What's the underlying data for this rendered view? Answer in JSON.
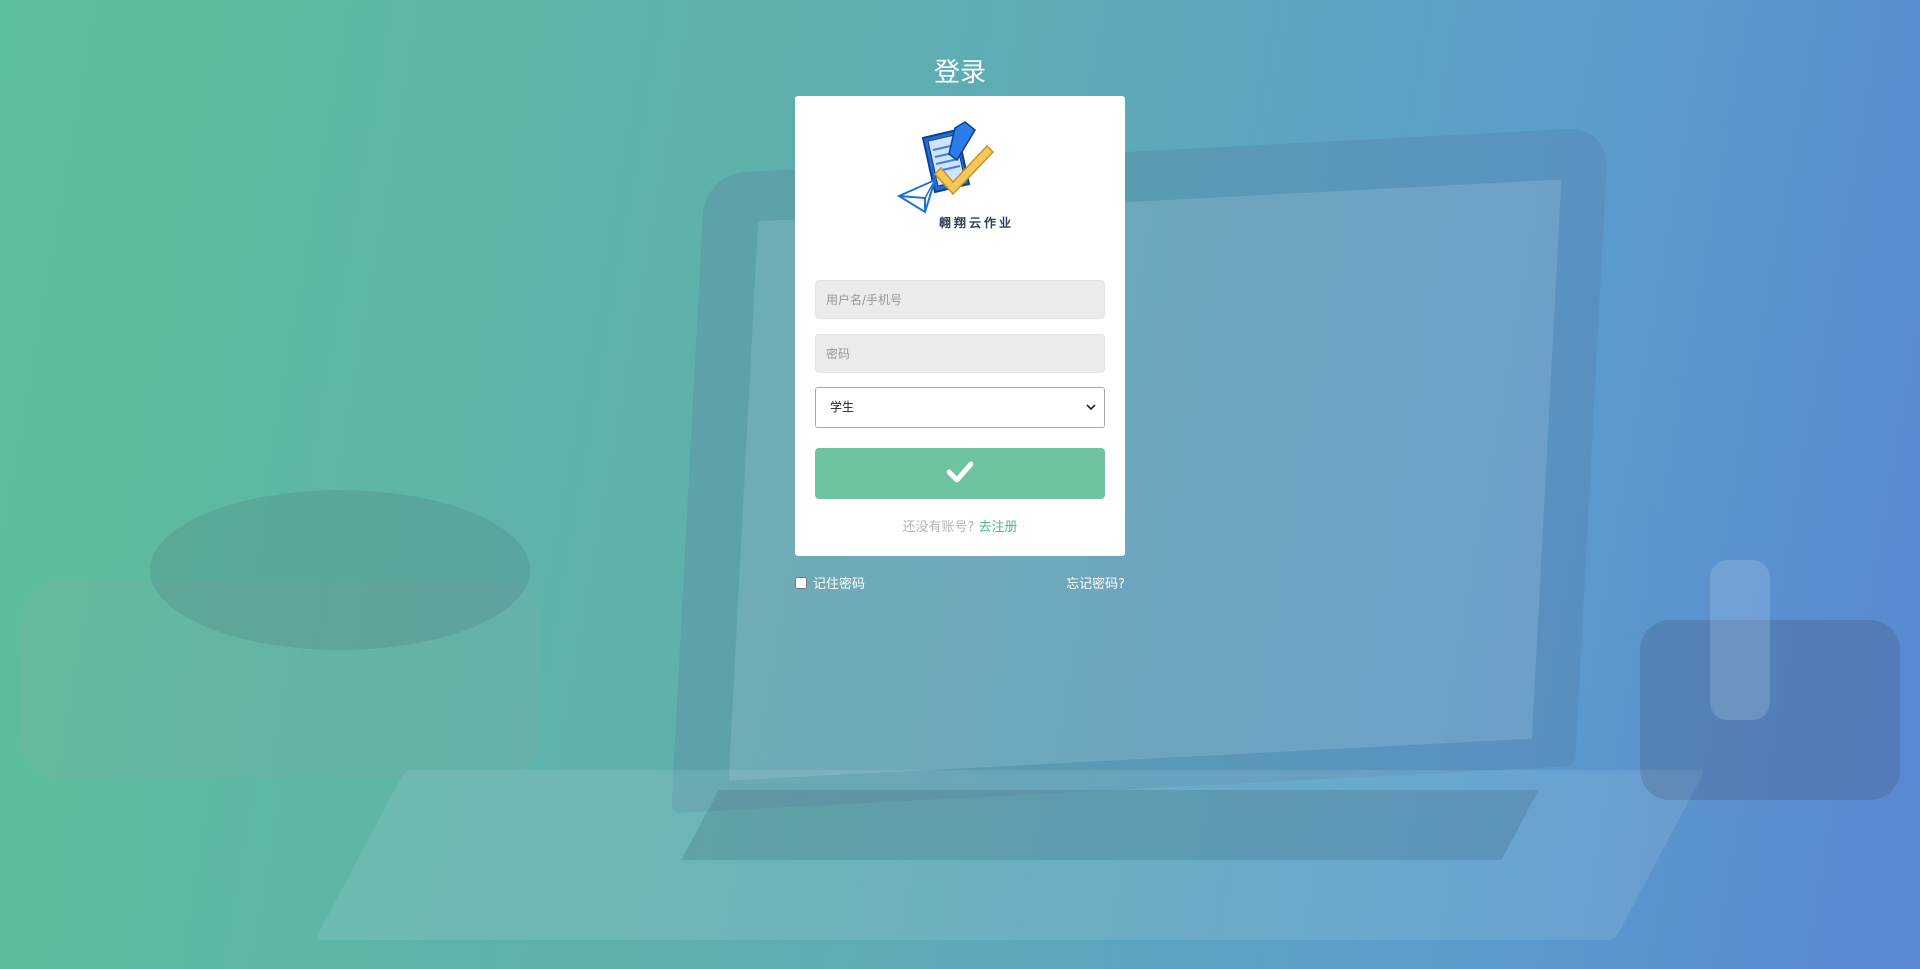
{
  "page": {
    "title": "登录"
  },
  "logo": {
    "text": "翱翔云作业"
  },
  "form": {
    "username_placeholder": "用户名/手机号",
    "password_placeholder": "密码",
    "role_selected": "学生",
    "submit_icon": "check-icon"
  },
  "register": {
    "prompt": "还没有账号?",
    "link": "去注册"
  },
  "footer": {
    "remember_label": "记住密码",
    "remember_checked": false,
    "forgot_label": "忘记密码?"
  },
  "colors": {
    "accent": "#6fc4a0",
    "link": "#4fb58c",
    "bg_start": "#5cbf9b",
    "bg_end": "#5a86d2"
  }
}
